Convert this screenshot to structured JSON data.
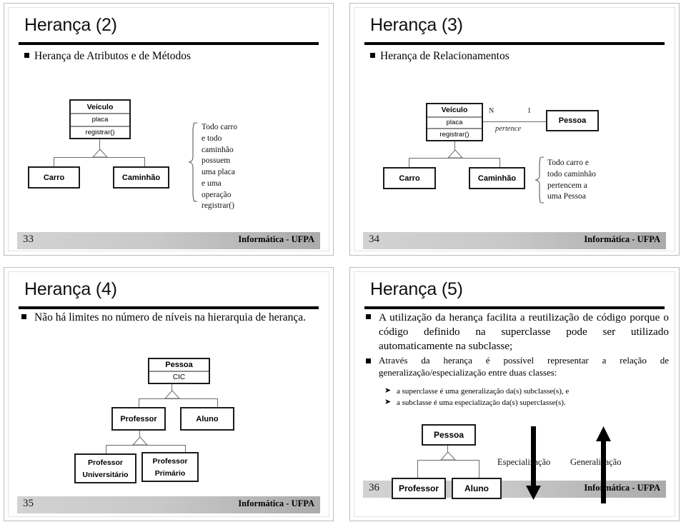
{
  "deck": {
    "brand": "Informática - UFPA",
    "slides": [
      {
        "id": "s2",
        "title": "Herança (2)",
        "page": "33",
        "bullet": "Herança de Atributos e de Métodos",
        "boxes": {
          "veiculo": {
            "name": "Veículo",
            "attr": "placa",
            "op": "registrar()"
          },
          "carro": "Carro",
          "caminhao": "Caminhão"
        },
        "note": [
          "Todo carro",
          "e todo",
          "caminhão",
          "possuem",
          "uma placa",
          "e uma",
          "operação",
          "registrar()"
        ]
      },
      {
        "id": "s3",
        "title": "Herança (3)",
        "page": "34",
        "bullet": "Herança de Relacionamentos",
        "boxes": {
          "veiculo": {
            "name": "Veículo",
            "attr": "placa",
            "op": "registrar()"
          },
          "carro": "Carro",
          "caminhao": "Caminhão",
          "pessoa": "Pessoa"
        },
        "relation": {
          "left_cardinality": "N",
          "right_cardinality": "I",
          "label": "pertence"
        },
        "note": [
          "Todo carro e",
          "todo caminhão",
          "pertencem a",
          "uma Pessoa"
        ]
      },
      {
        "id": "s4",
        "title": "Herança (4)",
        "page": "35",
        "bullet": "Não há limites no número de níveis na hierarquia de herança.",
        "boxes": {
          "pessoa": {
            "name": "Pessoa",
            "attr": "CIC"
          },
          "professor": "Professor",
          "aluno": "Aluno",
          "prof_univ_l1": "Professor",
          "prof_univ_l2": "Universitário",
          "prof_prim_l1": "Professor",
          "prof_prim_l2": "Primário"
        }
      },
      {
        "id": "s5",
        "title": "Herança (5)",
        "page": "36",
        "bullets": [
          "A utilização da herança facilita a reutilização de código porque o código definido na superclasse pode ser utilizado automaticamente na subclasse;",
          "Através da herança é possível representar a relação de generalização/especialização entre duas classes:"
        ],
        "subbullets": [
          "a superclasse é uma generalização da(s) subclasse(s), e",
          "a subclasse é uma especialização da(s) superclasse(s)."
        ],
        "boxes": {
          "pessoa": "Pessoa",
          "professor": "Professor",
          "aluno": "Aluno"
        },
        "arrows": {
          "down_label": "Especialização",
          "up_label": "Generalização"
        }
      }
    ]
  },
  "colors": {
    "box_border": "#1b1b1b",
    "connector": "#6b6b6b",
    "footer_light": "#d2d2d2",
    "footer_dark": "#ababab",
    "rule": "#000000"
  }
}
